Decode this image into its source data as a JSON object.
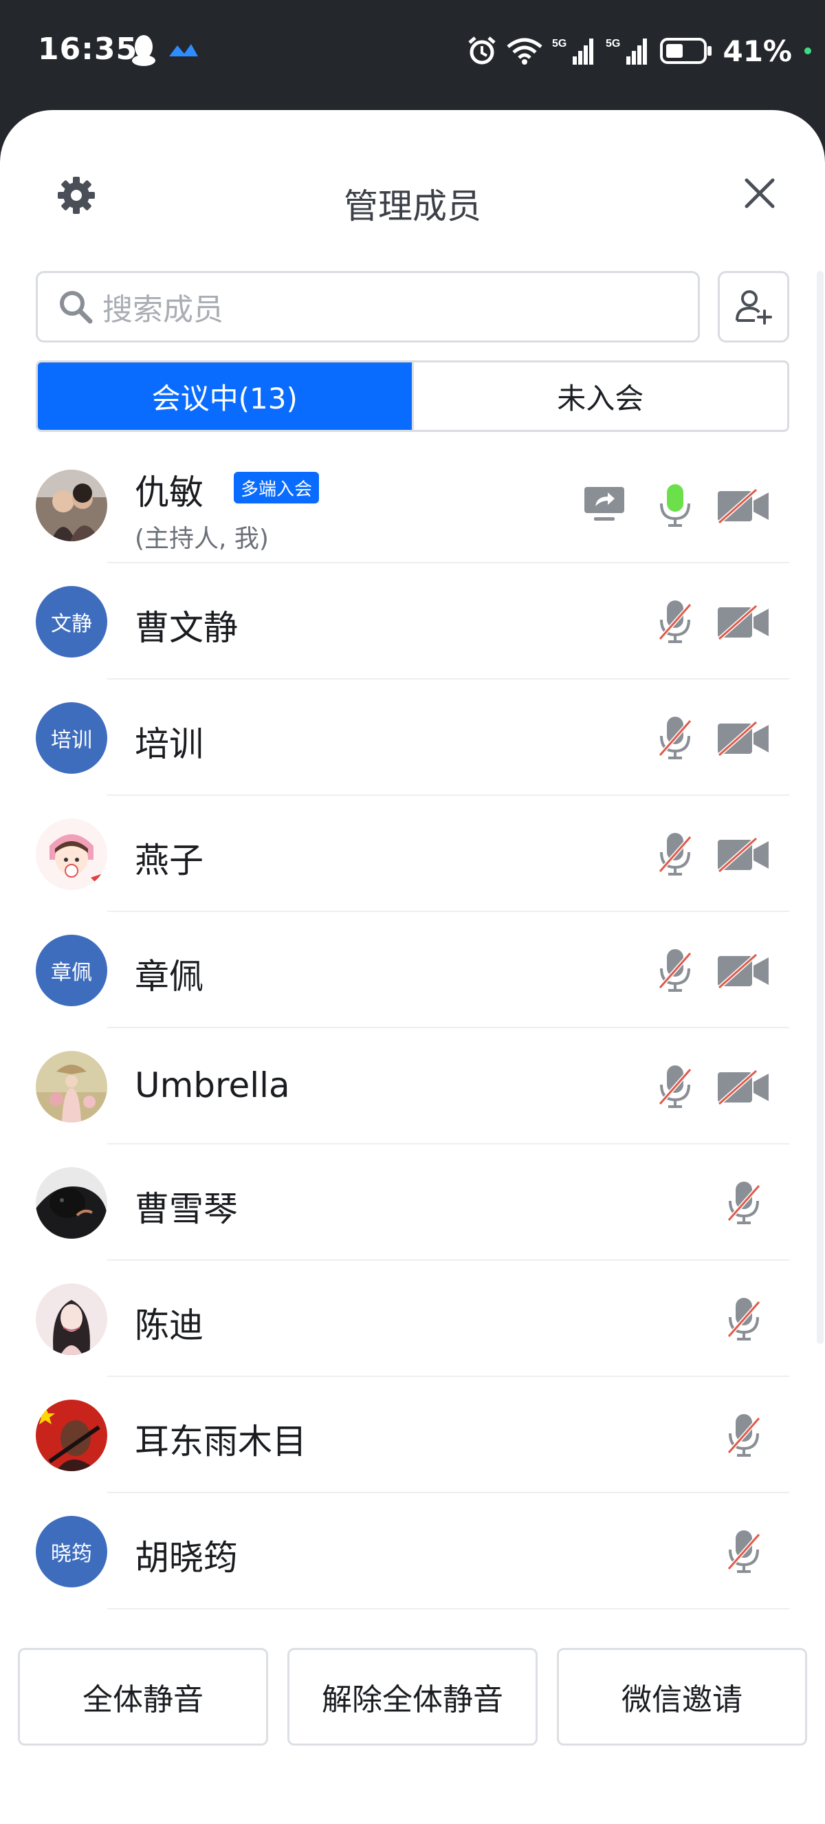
{
  "status_bar": {
    "time": "16:35",
    "battery": "41%",
    "icons": [
      "qq-icon",
      "app-icon",
      "alarm-icon",
      "wifi-icon",
      "signal-5g-icon",
      "signal-5g-icon",
      "battery-icon"
    ]
  },
  "header": {
    "title": "管理成员",
    "settings_icon": "gear-icon",
    "close_icon": "close-icon"
  },
  "search": {
    "placeholder": "搜索成员",
    "add_icon": "add-user-icon"
  },
  "tabs": [
    {
      "label": "会议中(13)",
      "active": true
    },
    {
      "label": "未入会",
      "active": false
    }
  ],
  "members": [
    {
      "name": "仇敏",
      "role": "(主持人, 我)",
      "badge": "多端入会",
      "avatar": "photo",
      "mic": "on",
      "camera": "off",
      "share": true
    },
    {
      "name": "曹文静",
      "avatar_text": "文静",
      "mic": "off",
      "camera": "off"
    },
    {
      "name": "培训",
      "avatar_text": "培训",
      "mic": "off",
      "camera": "off"
    },
    {
      "name": "燕子",
      "avatar": "photo",
      "mic": "off",
      "camera": "off"
    },
    {
      "name": "章佩",
      "avatar_text": "章佩",
      "mic": "off",
      "camera": "off"
    },
    {
      "name": "Umbrella",
      "avatar": "photo",
      "mic": "off",
      "camera": "off"
    },
    {
      "name": "曹雪琴",
      "avatar": "photo",
      "mic": "off"
    },
    {
      "name": "陈迪",
      "avatar": "photo",
      "mic": "off"
    },
    {
      "name": "耳东雨木目",
      "avatar": "photo",
      "mic": "off"
    },
    {
      "name": "胡晓筠",
      "avatar_text": "晓筠",
      "mic": "off"
    }
  ],
  "footer": {
    "mute_all": "全体静音",
    "unmute_all": "解除全体静音",
    "wechat_invite": "微信邀请"
  },
  "colors": {
    "accent": "#0a6cff",
    "avatar_blue": "#3e6dbe",
    "mic_on": "#6be04a",
    "muted_slash": "#e05a4a"
  }
}
